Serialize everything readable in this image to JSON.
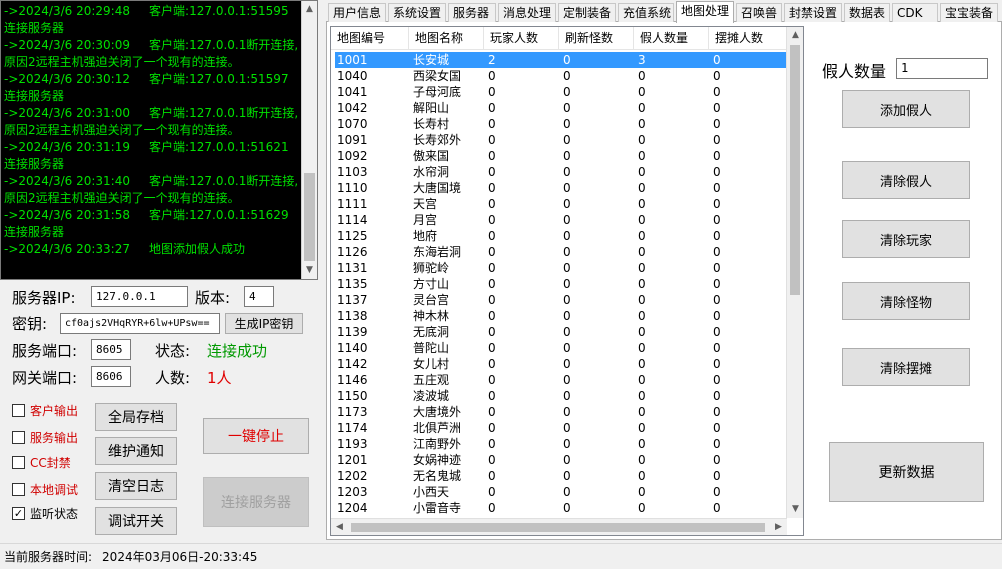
{
  "log": {
    "lines": [
      "->2024/3/6 20:29:48     客户端:127.0.0.1:51595连接服务器",
      "->2024/3/6 20:30:09     客户端:127.0.0.1断开连接,原因2远程主机强迫关闭了一个现有的连接。",
      "->2024/3/6 20:30:12     客户端:127.0.0.1:51597连接服务器",
      "->2024/3/6 20:31:00     客户端:127.0.0.1断开连接,原因2远程主机强迫关闭了一个现有的连接。",
      "->2024/3/6 20:31:19     客户端:127.0.0.1:51621连接服务器",
      "->2024/3/6 20:31:40     客户端:127.0.0.1断开连接,原因2远程主机强迫关闭了一个现有的连接。",
      "->2024/3/6 20:31:58     客户端:127.0.0.1:51629连接服务器",
      "->2024/3/6 20:33:27     地图添加假人成功"
    ]
  },
  "server": {
    "ip_label": "服务器IP:",
    "ip_value": "127.0.0.1",
    "version_label": "版本:",
    "version_value": "4",
    "key_label": "密钥:",
    "key_value": "cf0ajs2VHqRYR+6lw+UPsw==",
    "gen_key_button": "生成IP密钥",
    "port_label": "服务端口:",
    "port_value": "8605",
    "status_label": "状态:",
    "status_value": "连接成功",
    "gateway_label": "网关端口:",
    "gateway_value": "8606",
    "count_label": "人数:",
    "count_value": "1人"
  },
  "checkboxes": [
    {
      "label": "客户输出",
      "checked": false,
      "red": true
    },
    {
      "label": "服务输出",
      "checked": false,
      "red": true
    },
    {
      "label": "CC封禁",
      "checked": false,
      "red": true
    },
    {
      "label": "本地调试",
      "checked": false,
      "red": true
    },
    {
      "label": "监听状态",
      "checked": true,
      "red": false
    }
  ],
  "buttons": {
    "save_all": "全局存档",
    "maintenance": "维护通知",
    "clear_log": "清空日志",
    "debug_switch": "调试开关",
    "stop_all": "一键停止",
    "connect_server": "连接服务器"
  },
  "tabs": [
    {
      "label": "用户信息",
      "active": false
    },
    {
      "label": "系统设置",
      "active": false
    },
    {
      "label": "服务器",
      "active": false
    },
    {
      "label": "消息处理",
      "active": false
    },
    {
      "label": "定制装备",
      "active": false
    },
    {
      "label": "充值系统",
      "active": false
    },
    {
      "label": "地图处理",
      "active": true
    },
    {
      "label": "召唤兽",
      "active": false
    },
    {
      "label": "封禁设置",
      "active": false
    },
    {
      "label": "数据表",
      "active": false
    },
    {
      "label": "CDK",
      "active": false
    },
    {
      "label": "宝宝装备",
      "active": false
    }
  ],
  "grid": {
    "columns": [
      "地图编号",
      "地图名称",
      "玩家人数",
      "刷新怪数",
      "假人数量",
      "摆摊人数"
    ],
    "rows": [
      [
        "1001",
        "长安城",
        "2",
        "0",
        "3",
        "0"
      ],
      [
        "1040",
        "西梁女国",
        "0",
        "0",
        "0",
        "0"
      ],
      [
        "1041",
        "子母河底",
        "0",
        "0",
        "0",
        "0"
      ],
      [
        "1042",
        "解阳山",
        "0",
        "0",
        "0",
        "0"
      ],
      [
        "1070",
        "长寿村",
        "0",
        "0",
        "0",
        "0"
      ],
      [
        "1091",
        "长寿郊外",
        "0",
        "0",
        "0",
        "0"
      ],
      [
        "1092",
        "傲来国",
        "0",
        "0",
        "0",
        "0"
      ],
      [
        "1103",
        "水帘洞",
        "0",
        "0",
        "0",
        "0"
      ],
      [
        "1110",
        "大唐国境",
        "0",
        "0",
        "0",
        "0"
      ],
      [
        "1111",
        "天宫",
        "0",
        "0",
        "0",
        "0"
      ],
      [
        "1114",
        "月宫",
        "0",
        "0",
        "0",
        "0"
      ],
      [
        "1125",
        "地府",
        "0",
        "0",
        "0",
        "0"
      ],
      [
        "1126",
        "东海岩洞",
        "0",
        "0",
        "0",
        "0"
      ],
      [
        "1131",
        "狮驼岭",
        "0",
        "0",
        "0",
        "0"
      ],
      [
        "1135",
        "方寸山",
        "0",
        "0",
        "0",
        "0"
      ],
      [
        "1137",
        "灵台宫",
        "0",
        "0",
        "0",
        "0"
      ],
      [
        "1138",
        "神木林",
        "0",
        "0",
        "0",
        "0"
      ],
      [
        "1139",
        "无底洞",
        "0",
        "0",
        "0",
        "0"
      ],
      [
        "1140",
        "普陀山",
        "0",
        "0",
        "0",
        "0"
      ],
      [
        "1142",
        "女儿村",
        "0",
        "0",
        "0",
        "0"
      ],
      [
        "1146",
        "五庄观",
        "0",
        "0",
        "0",
        "0"
      ],
      [
        "1150",
        "凌波城",
        "0",
        "0",
        "0",
        "0"
      ],
      [
        "1173",
        "大唐境外",
        "0",
        "0",
        "0",
        "0"
      ],
      [
        "1174",
        "北俱芦洲",
        "0",
        "0",
        "0",
        "0"
      ],
      [
        "1193",
        "江南野外",
        "0",
        "0",
        "0",
        "0"
      ],
      [
        "1201",
        "女娲神迹",
        "0",
        "0",
        "0",
        "0"
      ],
      [
        "1202",
        "无名鬼城",
        "0",
        "0",
        "0",
        "0"
      ],
      [
        "1203",
        "小西天",
        "0",
        "0",
        "0",
        "0"
      ],
      [
        "1204",
        "小雷音寺",
        "0",
        "0",
        "0",
        "0"
      ]
    ]
  },
  "right_panel": {
    "fake_count_label": "假人数量",
    "fake_count_value": "1",
    "add_fake": "添加假人",
    "clear_fake": "清除假人",
    "clear_player": "清除玩家",
    "clear_monster": "清除怪物",
    "clear_stall": "清除摆摊",
    "refresh_data": "更新数据"
  },
  "statusbar": {
    "label": "当前服务器时间:",
    "value": "2024年03月06日-20:33:45"
  },
  "colors": {
    "log_text": "#00e000",
    "status_ok": "#009900",
    "count_red": "#e00000",
    "selection": "#3399ff"
  }
}
